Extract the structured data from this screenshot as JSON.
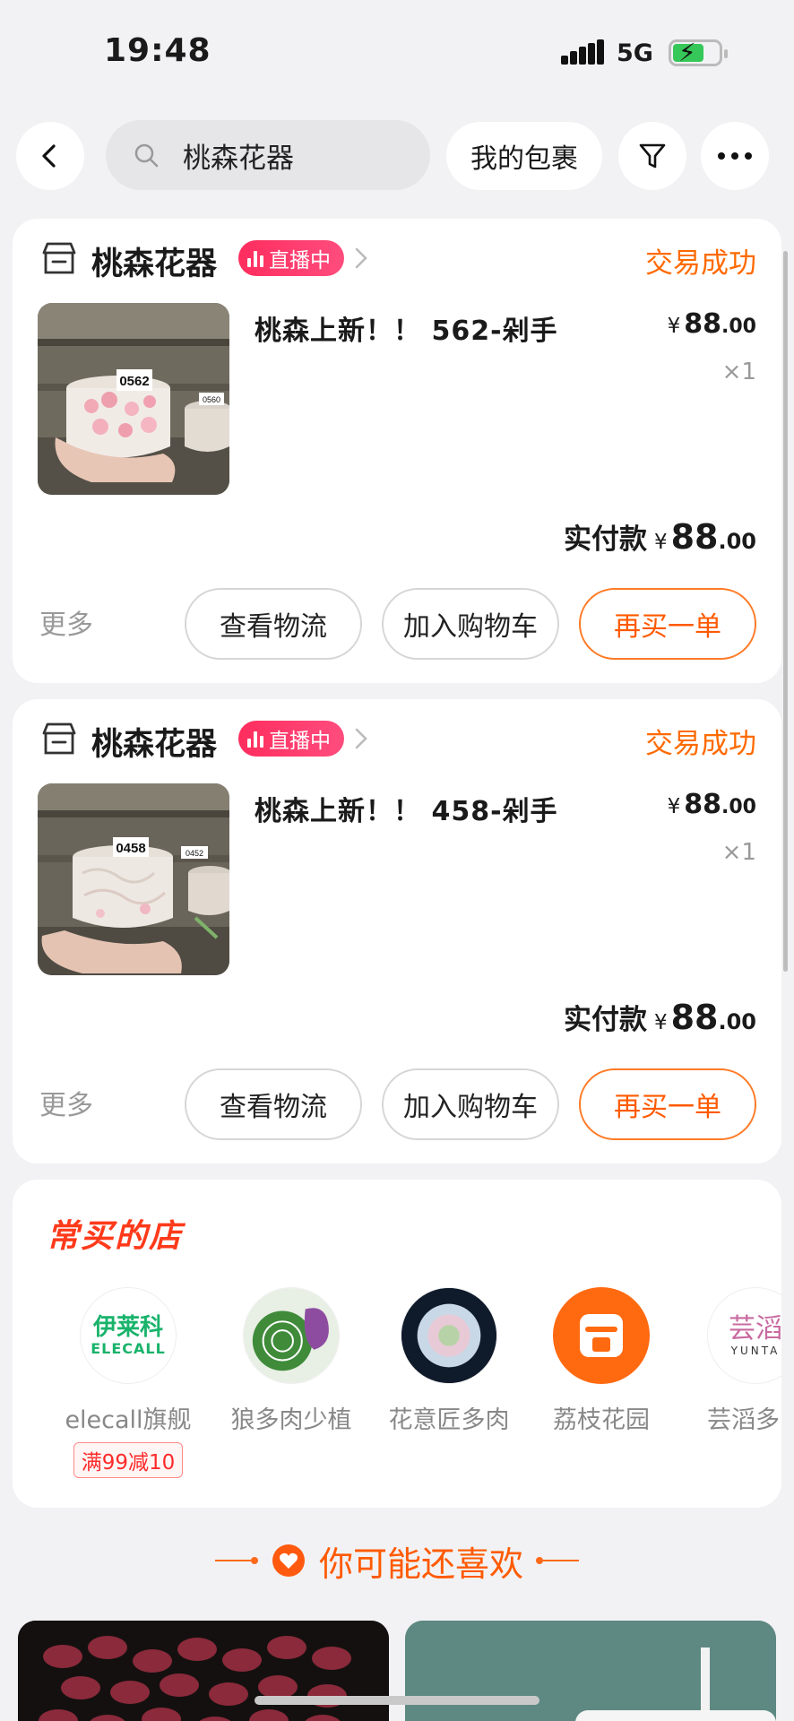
{
  "status_bar": {
    "time": "19:48",
    "network": "5G"
  },
  "header": {
    "search_text": "桃森花器",
    "packages_label": "我的包裹"
  },
  "orders": [
    {
      "shop_name": "桃森花器",
      "live_label": "直播中",
      "status": "交易成功",
      "product_title": "桃森上新！！ 562-剁手",
      "price_int": "88",
      "price_dec": ".00",
      "currency": "¥",
      "quantity": "×1",
      "paid_label": "实付款",
      "paid_int": "88",
      "paid_dec": ".00",
      "image_tag": "0562",
      "image_tag2": "0560",
      "more_label": "更多",
      "logistics_label": "查看物流",
      "cart_label": "加入购物车",
      "rebuy_label": "再买一单"
    },
    {
      "shop_name": "桃森花器",
      "live_label": "直播中",
      "status": "交易成功",
      "product_title": "桃森上新！！ 458-剁手",
      "price_int": "88",
      "price_dec": ".00",
      "currency": "¥",
      "quantity": "×1",
      "paid_label": "实付款",
      "paid_int": "88",
      "paid_dec": ".00",
      "image_tag": "0458",
      "image_tag2": "0452",
      "more_label": "更多",
      "logistics_label": "查看物流",
      "cart_label": "加入购物车",
      "rebuy_label": "再买一单"
    }
  ],
  "frequent_shops": {
    "title": "常买的店",
    "shops": [
      {
        "name": "elecall旗舰",
        "logo_text": "伊莱科",
        "logo_sub": "ELECALL",
        "promo": "满99减10"
      },
      {
        "name": "狼多肉少植"
      },
      {
        "name": "花意匠多肉"
      },
      {
        "name": "荔枝花园"
      },
      {
        "name": "芸滔多肉",
        "logo_sub": "YUNTA"
      }
    ]
  },
  "recommend": {
    "title": "你可能还喜欢"
  },
  "colors": {
    "accent": "#ff6a00",
    "live": "#ff2d5e",
    "promo": "#ff2a2a"
  }
}
